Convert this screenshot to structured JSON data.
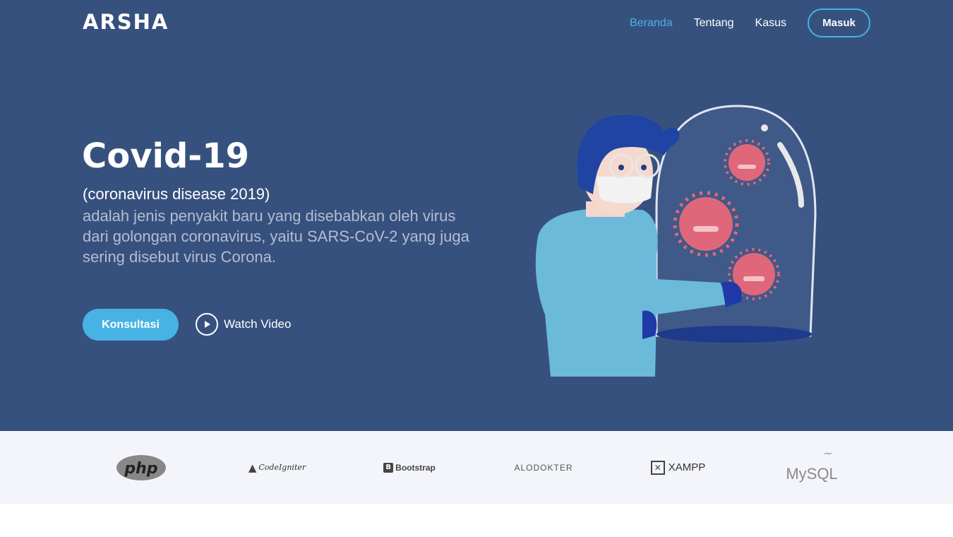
{
  "header": {
    "logo": "ARSHA",
    "nav": [
      {
        "label": "Beranda",
        "active": true
      },
      {
        "label": "Tentang",
        "active": false
      },
      {
        "label": "Kasus",
        "active": false
      }
    ],
    "login_label": "Masuk"
  },
  "hero": {
    "title": "Covid-19",
    "subtitle": "(coronavirus disease 2019)",
    "description": "adalah jenis penyakit baru yang disebabkan oleh virus dari golongan coronavirus, yaitu SARS-CoV-2 yang juga sering disebut virus Corona.",
    "primary_button": "Konsultasi",
    "video_button": "Watch Video",
    "illustration_icon": "doctor-holding-virus-jar-illustration"
  },
  "clients": [
    {
      "name": "php",
      "icon": "php-logo"
    },
    {
      "name": "CodeIgniter",
      "icon": "codeigniter-logo"
    },
    {
      "name": "Bootstrap",
      "icon": "bootstrap-logo"
    },
    {
      "name": "ALODOKTER",
      "icon": "alodokter-logo"
    },
    {
      "name": "XAMPP",
      "icon": "xampp-logo"
    },
    {
      "name": "MySQL",
      "icon": "mysql-logo"
    }
  ],
  "colors": {
    "hero_bg": "#37517e",
    "accent": "#47b2e4",
    "clients_bg": "#f3f5fa"
  }
}
